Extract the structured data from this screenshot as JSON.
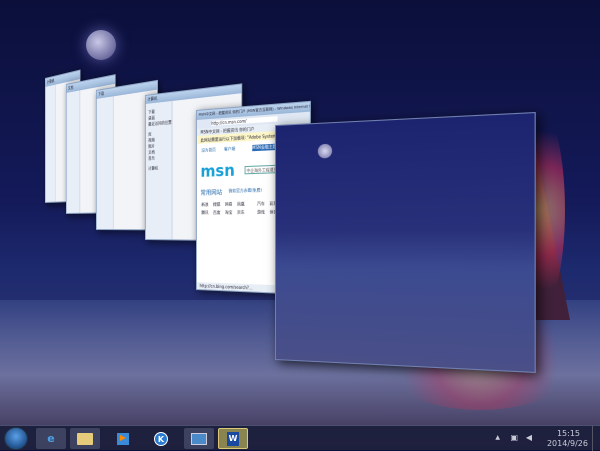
{
  "windows": [
    {
      "title": "计算机"
    },
    {
      "title": "文档"
    },
    {
      "title": "下载"
    },
    {
      "title": "计算机",
      "items": [
        "下载",
        "桌面",
        "最近访问的位置",
        "库",
        "视频",
        "图片",
        "文档",
        "音乐",
        "计算机"
      ]
    },
    {
      "title": "MSN中文网 - 把握资讯 你的门户 (MSN官方互联网) - Windows Internet Explorer",
      "address": "http://cn.msn.com/",
      "tab": "MSN中文网 - 把握资讯 你的门户",
      "notice": "此网站需要运行以下加载项: \"Adobe Systems Incorporated\"",
      "links": [
        "设为首页",
        "客户端",
        "MSN金融主题手机站"
      ],
      "logo": "msn",
      "search_placeholder": "中企海外工程遭到",
      "section": "常用网站",
      "promo": "微软官方赤霉(免费)",
      "grid": [
        "新浪",
        "搜狐",
        "网易",
        "凤凰",
        "腾讯",
        "百度",
        "淘宝",
        "京东",
        "汽车",
        "彩票",
        "游戏",
        "体育"
      ],
      "status": "http://cn.bing.com/search?..."
    },
    {
      "title": "桌面"
    }
  ],
  "taskbar": {
    "apps": [
      "internet-explorer",
      "windows-explorer",
      "media-player",
      "kugou",
      "remote-desktop",
      "word"
    ],
    "active": "word",
    "time": "15:15",
    "date": "2014/9/26"
  },
  "colors": {
    "taskbar": "#1e223c",
    "active": "#d8c878"
  }
}
